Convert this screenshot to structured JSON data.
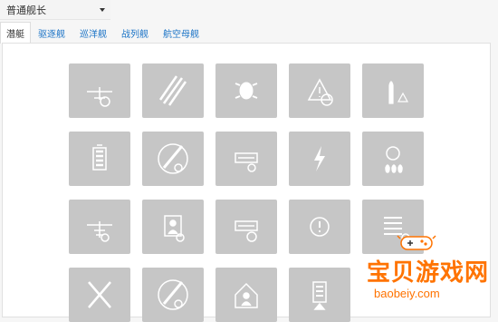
{
  "selector": {
    "value": "普通舰长"
  },
  "tabs": [
    {
      "label": "潜艇",
      "active": true
    },
    {
      "label": "驱逐舰"
    },
    {
      "label": "巡洋舰"
    },
    {
      "label": "战列舰"
    },
    {
      "label": "航空母舰"
    }
  ],
  "skills": [
    {
      "icon": "plane-reload-icon"
    },
    {
      "icon": "torpedoes-icon"
    },
    {
      "icon": "turtle-shell-icon"
    },
    {
      "icon": "warning-radar-icon"
    },
    {
      "icon": "shell-alert-icon"
    },
    {
      "icon": "battery-icon"
    },
    {
      "icon": "torpedo-reload-icon"
    },
    {
      "icon": "launcher-reload-icon"
    },
    {
      "icon": "lightning-icon"
    },
    {
      "icon": "fire-suppression-icon"
    },
    {
      "icon": "aircraft-boost-icon"
    },
    {
      "icon": "crew-timer-icon"
    },
    {
      "icon": "launcher-timer-icon"
    },
    {
      "icon": "exclamation-icon"
    },
    {
      "icon": "list-upgrade-icon"
    },
    {
      "icon": "crossed-torpedoes-icon"
    },
    {
      "icon": "torpedo-timer-icon"
    },
    {
      "icon": "house-crew-icon"
    },
    {
      "icon": "battery-upgrade-icon"
    }
  ],
  "watermark": {
    "title": "宝贝游戏网",
    "url": "baobeiy.com"
  },
  "colors": {
    "tile": "#c6c6c6",
    "link": "#1a73c6",
    "watermark": "#ff7300"
  }
}
